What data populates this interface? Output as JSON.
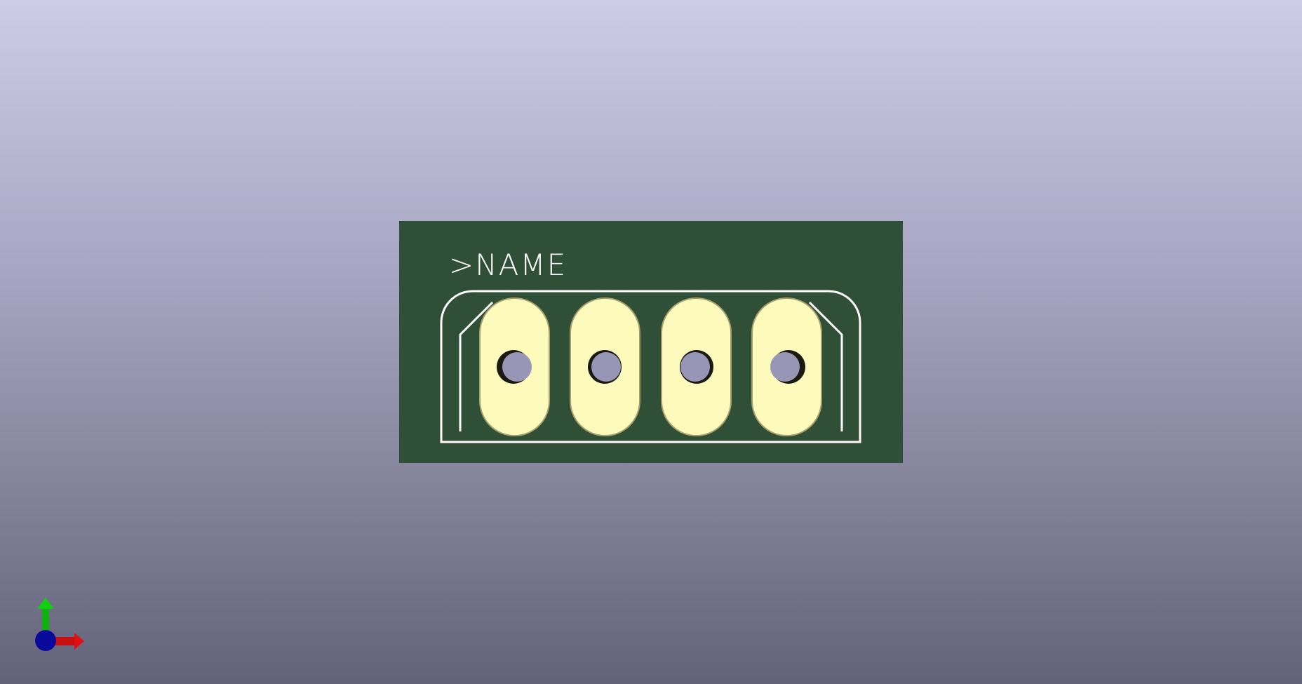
{
  "scene": {
    "board": {
      "silkscreen_label": ">NAME",
      "colors": {
        "soldermask": "#2f4f37",
        "silkscreen": "#ffffff",
        "pad": "#fdfbbb",
        "pad_outline": "#a89f6e",
        "hole": "#9896b6",
        "hole_shadow": "#1a1a12"
      },
      "pads": [
        {
          "id": "pad-1"
        },
        {
          "id": "pad-2"
        },
        {
          "id": "pad-3"
        },
        {
          "id": "pad-4"
        }
      ]
    },
    "axis_triad": {
      "x_color": "#e01010",
      "y_color": "#10d010",
      "z_color": "#0a0a9a",
      "icons": [
        "x-axis-arrow-icon",
        "y-axis-arrow-icon",
        "z-axis-origin-icon"
      ]
    }
  }
}
